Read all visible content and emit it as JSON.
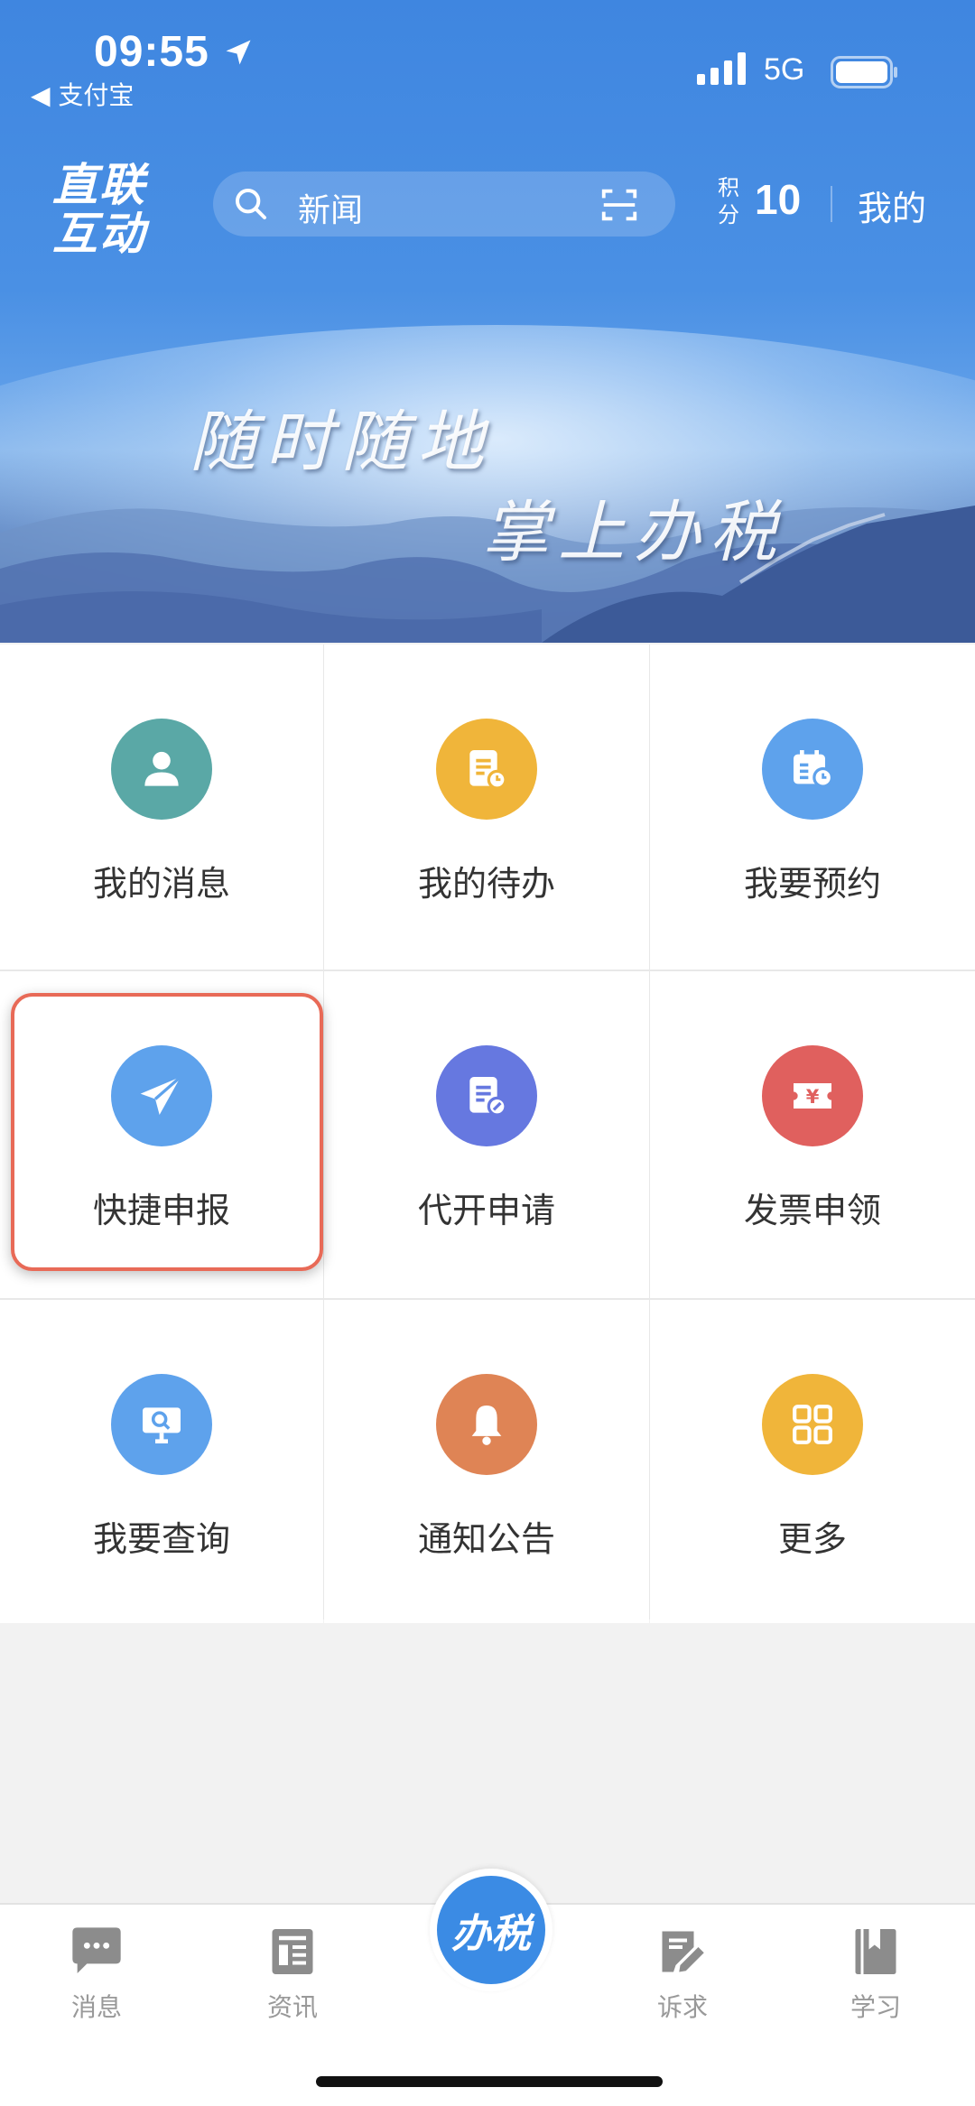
{
  "status_bar": {
    "time": "09:55",
    "back_app": "◀ 支付宝",
    "network": "5G"
  },
  "header": {
    "logo_line1": "直联",
    "logo_line2": "互动",
    "search_placeholder": "新闻",
    "points_label": "积分",
    "points_value": "10",
    "mine_label": "我的"
  },
  "banner": {
    "line1": "随时随地",
    "line2": "掌上办税"
  },
  "grid": {
    "items": [
      {
        "label": "我的消息",
        "color": "#5aa8a6",
        "icon": "user-icon"
      },
      {
        "label": "我的待办",
        "color": "#f0b53a",
        "icon": "document-clock-icon"
      },
      {
        "label": "我要预约",
        "color": "#5ea2ec",
        "icon": "calendar-clock-icon"
      },
      {
        "label": "快捷申报",
        "color": "#5ea2ec",
        "icon": "paper-plane-icon"
      },
      {
        "label": "代开申请",
        "color": "#6678e0",
        "icon": "document-edit-icon"
      },
      {
        "label": "发票申领",
        "color": "#e0605e",
        "icon": "ticket-yen-icon"
      },
      {
        "label": "我要查询",
        "color": "#5ea2ec",
        "icon": "monitor-search-icon"
      },
      {
        "label": "通知公告",
        "color": "#df8455",
        "icon": "bell-icon"
      },
      {
        "label": "更多",
        "color": "#f0b53a",
        "icon": "grid-icon"
      }
    ]
  },
  "tabbar": {
    "items": [
      {
        "label": "消息",
        "icon": "chat-icon"
      },
      {
        "label": "资讯",
        "icon": "news-icon"
      },
      {
        "label": "办税",
        "icon": "tax-center-icon"
      },
      {
        "label": "诉求",
        "icon": "edit-icon"
      },
      {
        "label": "学习",
        "icon": "book-icon"
      }
    ]
  }
}
